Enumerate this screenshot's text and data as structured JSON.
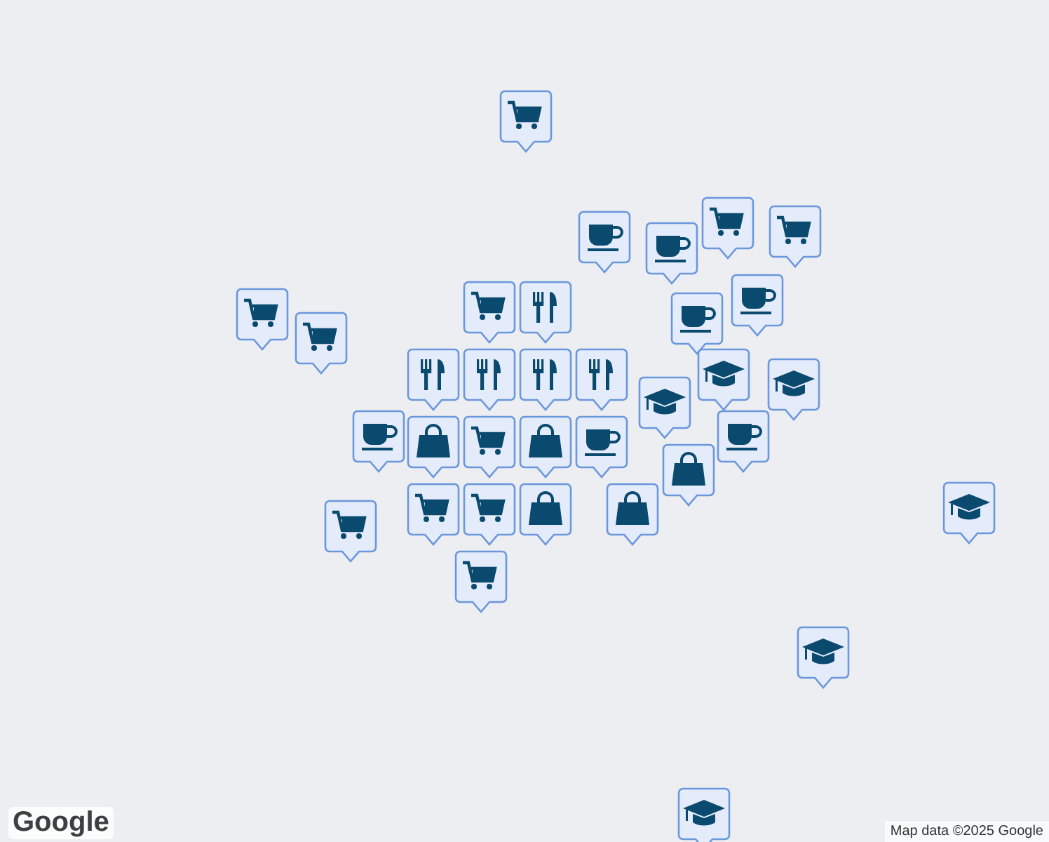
{
  "markers": [
    {
      "kind": "cart"
    },
    {
      "kind": "cart"
    },
    {
      "kind": "cart"
    },
    {
      "kind": "cup"
    },
    {
      "kind": "cup"
    },
    {
      "kind": "cart"
    },
    {
      "kind": "cart"
    },
    {
      "kind": "cup"
    },
    {
      "kind": "cup"
    },
    {
      "kind": "fork"
    },
    {
      "kind": "fork"
    },
    {
      "kind": "fork"
    },
    {
      "kind": "fork"
    },
    {
      "kind": "fork"
    },
    {
      "kind": "grad"
    },
    {
      "kind": "grad"
    },
    {
      "kind": "grad"
    },
    {
      "kind": "cart"
    },
    {
      "kind": "cart"
    },
    {
      "kind": "cup"
    },
    {
      "kind": "bag"
    },
    {
      "kind": "bag"
    },
    {
      "kind": "cup"
    },
    {
      "kind": "cart"
    },
    {
      "kind": "bag"
    },
    {
      "kind": "bag"
    },
    {
      "kind": "cup"
    },
    {
      "kind": "cart"
    },
    {
      "kind": "cart"
    },
    {
      "kind": "bag"
    },
    {
      "kind": "cart"
    },
    {
      "kind": "grad"
    },
    {
      "kind": "grad"
    },
    {
      "kind": "grad"
    }
  ],
  "logo": "Google",
  "attribution": "Map data ©2025 Google"
}
